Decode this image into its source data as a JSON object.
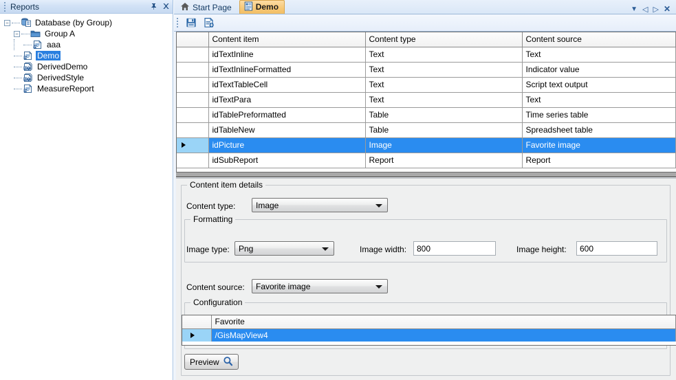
{
  "reports_panel": {
    "title": "Reports",
    "pin_icon": "pin-icon",
    "close_icon": "close-icon",
    "tree": [
      {
        "label": "Database (by Group)",
        "level": 0,
        "expander": "-",
        "icon": "database-icon",
        "selected": false
      },
      {
        "label": "Group A",
        "level": 1,
        "expander": "-",
        "icon": "folder-icon",
        "selected": false
      },
      {
        "label": "aaa",
        "level": 2,
        "expander": "",
        "icon": "report-icon",
        "selected": false
      },
      {
        "label": "Demo",
        "level": 1,
        "expander": "",
        "icon": "report-icon",
        "selected": true
      },
      {
        "label": "DerivedDemo",
        "level": 1,
        "expander": "",
        "icon": "derived-report-icon",
        "selected": false
      },
      {
        "label": "DerivedStyle",
        "level": 1,
        "expander": "",
        "icon": "derived-report-icon",
        "selected": false
      },
      {
        "label": "MeasureReport",
        "level": 1,
        "expander": "",
        "icon": "report-icon",
        "selected": false
      }
    ]
  },
  "tabs": [
    {
      "label": "Start Page",
      "icon": "home-icon",
      "active": false
    },
    {
      "label": "Demo",
      "icon": "report-icon",
      "active": true
    }
  ],
  "tab_controls": [
    {
      "name": "tab-list-dropdown",
      "glyph": "▼"
    },
    {
      "name": "tab-scroll-left",
      "glyph": "◁"
    },
    {
      "name": "tab-scroll-right",
      "glyph": "▷"
    },
    {
      "name": "tab-close",
      "glyph": "✕"
    }
  ],
  "toolbar": {
    "buttons": [
      {
        "name": "save-button",
        "icon": "save-icon"
      },
      {
        "name": "save-as-button",
        "icon": "save-as-icon"
      }
    ]
  },
  "content_grid": {
    "columns": [
      "",
      "Content item",
      "Content type",
      "Content source"
    ],
    "rows": [
      {
        "item": "idTextInline",
        "type": "Text",
        "source": "Text",
        "selected": false
      },
      {
        "item": "idTextInlineFormatted",
        "type": "Text",
        "source": "Indicator value",
        "selected": false
      },
      {
        "item": "idTextTableCell",
        "type": "Text",
        "source": "Script text output",
        "selected": false
      },
      {
        "item": "idTextPara",
        "type": "Text",
        "source": "Text",
        "selected": false
      },
      {
        "item": "idTablePreformatted",
        "type": "Table",
        "source": "Time series table",
        "selected": false
      },
      {
        "item": "idTableNew",
        "type": "Table",
        "source": "Spreadsheet table",
        "selected": false
      },
      {
        "item": "idPicture",
        "type": "Image",
        "source": "Favorite image",
        "selected": true
      },
      {
        "item": "idSubReport",
        "type": "Report",
        "source": "Report",
        "selected": false
      }
    ]
  },
  "details": {
    "group_title": "Content item details",
    "content_type_label": "Content type:",
    "content_type_value": "Image",
    "formatting": {
      "group_title": "Formatting",
      "image_type_label": "Image type:",
      "image_type_value": "Png",
      "image_width_label": "Image width:",
      "image_width_value": "800",
      "image_height_label": "Image height:",
      "image_height_value": "600"
    },
    "content_source_label": "Content source:",
    "content_source_value": "Favorite image",
    "configuration": {
      "group_title": "Configuration",
      "columns": [
        "",
        "Favorite"
      ],
      "rows": [
        {
          "favorite": "/GisMapView4",
          "selected": true
        }
      ]
    },
    "preview_button": "Preview",
    "preview_icon": "magnifier-icon"
  },
  "colors": {
    "selection_blue": "#2a8cf0",
    "row_selector_blue": "#9ad4f7",
    "active_tab_orange": "#f3bf66",
    "panel_header_blue": "#c6d9f1"
  }
}
